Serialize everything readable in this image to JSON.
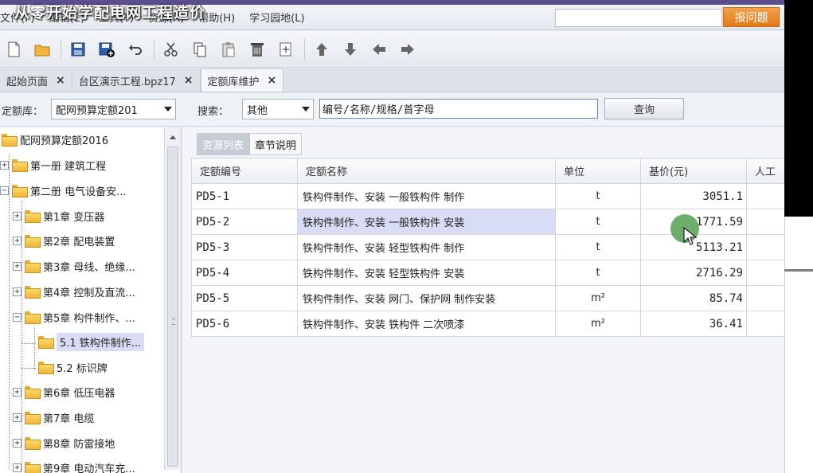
{
  "overlay_title": "从零开始学配电网工程造价",
  "menu": [
    "文件(F)",
    "编辑(E)",
    "工具(T)",
    "资源(R)",
    "帮助(H)",
    "学习园地(L)"
  ],
  "header": {
    "ask_button": "报问题"
  },
  "tabs": [
    {
      "label": "起始页面",
      "close": "×"
    },
    {
      "label": "台区演示工程.bpz17",
      "close": "×"
    },
    {
      "label": "定额库维护",
      "close": "×"
    }
  ],
  "filter": {
    "library_label": "定额库：",
    "library_value": "配网预算定额201",
    "search_label": "搜索：",
    "search_type": "其他",
    "search_placeholder": "编号/名称/规格/首字母",
    "query_button": "查询"
  },
  "tree": {
    "root": "配网预算定额2016",
    "book1": "第一册 建筑工程",
    "book2": "第二册 电气设备安...",
    "chapters": [
      "第1章 变压器",
      "第2章 配电装置",
      "第3章 母线、绝缘...",
      "第4章 控制及直流...",
      "第5章 构件制作、..."
    ],
    "sub": [
      "5.1 铁构件制作...",
      "5.2 标识牌"
    ],
    "chapters_after": [
      "第6章 低压电器",
      "第7章 电缆",
      "第8章 防雷接地",
      "第9章 电动汽车充..."
    ]
  },
  "subtabs": [
    "资源列表",
    "章节说明"
  ],
  "grid": {
    "headers": [
      "定额编号",
      "定额名称",
      "单位",
      "基价(元)",
      "人工"
    ],
    "rows": [
      {
        "code": "PD5-1",
        "name": "铁构件制作、安装 一般铁构件 制作",
        "unit": "t",
        "price": "3051.1"
      },
      {
        "code": "PD5-2",
        "name": "铁构件制作、安装 一般铁构件 安装",
        "unit": "t",
        "price": "1771.59"
      },
      {
        "code": "PD5-3",
        "name": "铁构件制作、安装 轻型铁构件 制作",
        "unit": "t",
        "price": "5113.21"
      },
      {
        "code": "PD5-4",
        "name": "铁构件制作、安装 轻型铁构件 安装",
        "unit": "t",
        "price": "2716.29"
      },
      {
        "code": "PD5-5",
        "name": "铁构件制作、安装 网门、保护网 制作安装",
        "unit": "m²",
        "price": "85.74"
      },
      {
        "code": "PD5-6",
        "name": "铁构件制作、安装 铁构件 二次喷漆",
        "unit": "m²",
        "price": "36.41"
      }
    ]
  }
}
